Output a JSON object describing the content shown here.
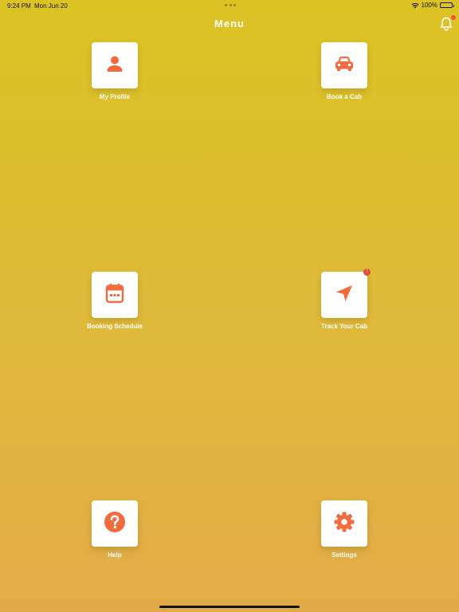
{
  "status_bar": {
    "time": "9:24 PM",
    "date": "Mon Jun 20",
    "battery": "100%"
  },
  "nav": {
    "title": "Menu",
    "notification_icon": "bell-icon"
  },
  "menu": {
    "items": [
      {
        "label": "My Profile",
        "icon": "person-icon"
      },
      {
        "label": "Book a Cab",
        "icon": "car-icon"
      },
      {
        "label": "Booking Schedule",
        "icon": "calendar-icon"
      },
      {
        "label": "Track Your Cab",
        "icon": "navigation-arrow-icon",
        "badge": "!"
      },
      {
        "label": "Help",
        "icon": "question-circle-icon"
      },
      {
        "label": "Settings",
        "icon": "gear-icon"
      }
    ]
  },
  "colors": {
    "accent": "#f26a3d",
    "background_top": "#dcc323",
    "background_bottom": "#e2ab48",
    "badge": "#e84a3a"
  }
}
